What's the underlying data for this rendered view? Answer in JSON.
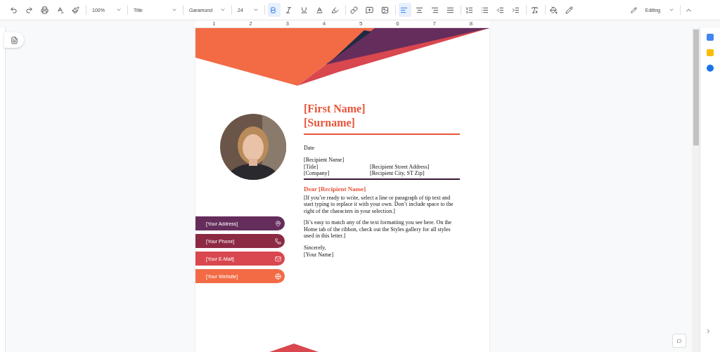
{
  "toolbar": {
    "zoom": "100%",
    "style": "Title",
    "font": "Garamond",
    "size": "24",
    "format": [
      {
        "kind": "bold",
        "selected": true
      },
      {
        "kind": "italic",
        "selected": false
      },
      {
        "kind": "underline",
        "selected": false
      }
    ],
    "align": [
      {
        "kind": "left",
        "selected": true
      },
      {
        "kind": "center",
        "selected": false
      },
      {
        "kind": "right",
        "selected": false
      },
      {
        "kind": "justify",
        "selected": false
      }
    ],
    "mode": "Editing"
  },
  "ruler": [
    "1",
    "2",
    "3",
    "4",
    "5",
    "6",
    "7",
    "8"
  ],
  "document": {
    "first_name": "[First Name]",
    "surname": "[Surname]",
    "date": "Date",
    "recipient": [
      {
        "left": "[Recipient Name]"
      },
      {
        "left": "[Title]",
        "right": "[Recipient Street Address]"
      },
      {
        "left": "[Company]",
        "right": "[Recipient City, ST Zip]"
      }
    ],
    "greeting": "Dear [Recipient Name]",
    "paragraphs": [
      "[If you’re ready to write, select a line or paragraph of tip text and start typing to replace it with your own. Don’t include space to the right of the characters in your selection.]",
      "[It’s easy to match any of the text formatting you see here. On the Home tab of the ribbon, check out the Styles gallery for all styles used in this letter.]"
    ],
    "closing": "Sincerely,",
    "signature": "[Your Name]",
    "contacts": [
      {
        "label": "[Your Address]",
        "kind": "address",
        "color": "#652d5c"
      },
      {
        "label": "[Your Phone]",
        "kind": "phone",
        "color": "#8c2a43"
      },
      {
        "label": "[Your E-Mail]",
        "kind": "email",
        "color": "#d9474f"
      },
      {
        "label": "[Your Website]",
        "kind": "website",
        "color": "#f26b45"
      }
    ]
  }
}
